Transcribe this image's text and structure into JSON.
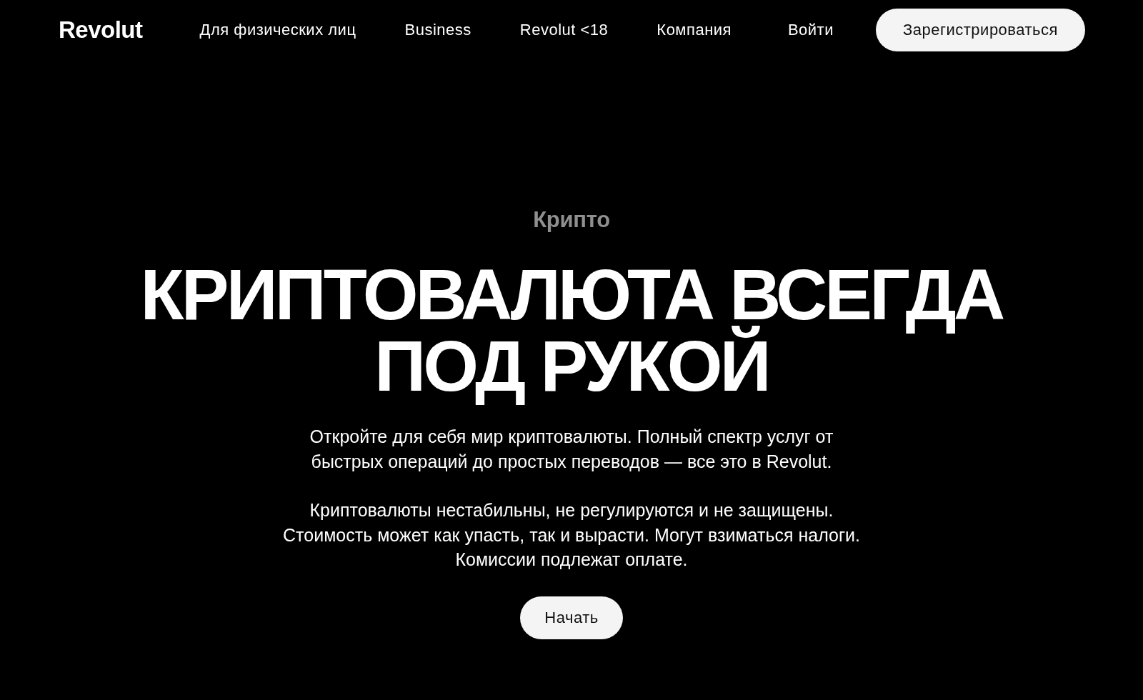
{
  "header": {
    "logo": "Revolut",
    "nav_items": [
      "Для физических лиц",
      "Business",
      "Revolut <18",
      "Компания"
    ],
    "login": "Войти",
    "signup_button": "Зарегистрироваться"
  },
  "hero": {
    "eyebrow": "Крипто",
    "headline": "КРИПТОВАЛЮТА ВСЕГДА ПОД РУКОЙ",
    "paragraphs": [
      "Откройте для себя мир криптовалюты. Полный спектр услуг от быстрых операций до простых переводов — все это в Revolut.",
      "Криптовалюты нестабильны, не регулируются и не защищены. Стоимость может как упасть, так и вырасти. Могут взиматься налоги. Комиссии подлежат оплате."
    ],
    "cta_button": "Начать"
  }
}
